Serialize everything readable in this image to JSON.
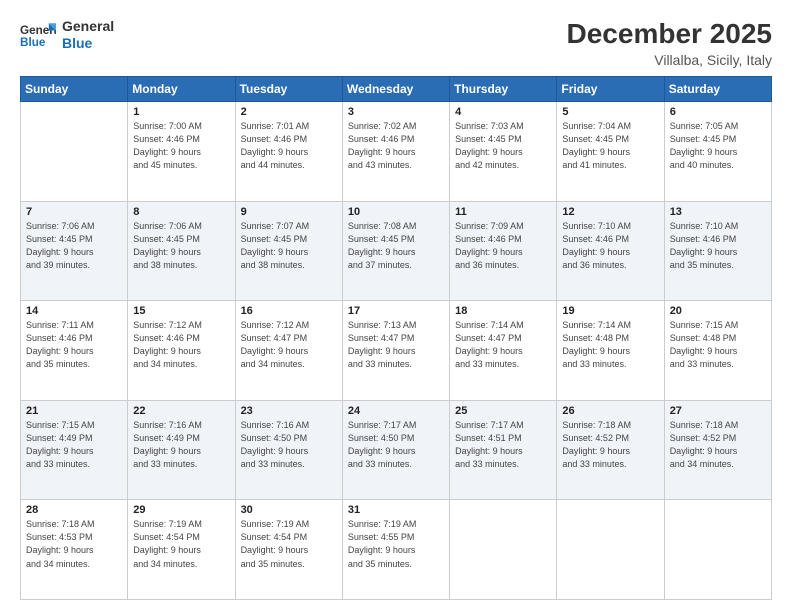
{
  "logo": {
    "line1": "General",
    "line2": "Blue"
  },
  "title": "December 2025",
  "subtitle": "Villalba, Sicily, Italy",
  "days_header": [
    "Sunday",
    "Monday",
    "Tuesday",
    "Wednesday",
    "Thursday",
    "Friday",
    "Saturday"
  ],
  "weeks": [
    [
      {
        "day": "",
        "info": ""
      },
      {
        "day": "1",
        "info": "Sunrise: 7:00 AM\nSunset: 4:46 PM\nDaylight: 9 hours\nand 45 minutes."
      },
      {
        "day": "2",
        "info": "Sunrise: 7:01 AM\nSunset: 4:46 PM\nDaylight: 9 hours\nand 44 minutes."
      },
      {
        "day": "3",
        "info": "Sunrise: 7:02 AM\nSunset: 4:46 PM\nDaylight: 9 hours\nand 43 minutes."
      },
      {
        "day": "4",
        "info": "Sunrise: 7:03 AM\nSunset: 4:45 PM\nDaylight: 9 hours\nand 42 minutes."
      },
      {
        "day": "5",
        "info": "Sunrise: 7:04 AM\nSunset: 4:45 PM\nDaylight: 9 hours\nand 41 minutes."
      },
      {
        "day": "6",
        "info": "Sunrise: 7:05 AM\nSunset: 4:45 PM\nDaylight: 9 hours\nand 40 minutes."
      }
    ],
    [
      {
        "day": "7",
        "info": "Sunrise: 7:06 AM\nSunset: 4:45 PM\nDaylight: 9 hours\nand 39 minutes."
      },
      {
        "day": "8",
        "info": "Sunrise: 7:06 AM\nSunset: 4:45 PM\nDaylight: 9 hours\nand 38 minutes."
      },
      {
        "day": "9",
        "info": "Sunrise: 7:07 AM\nSunset: 4:45 PM\nDaylight: 9 hours\nand 38 minutes."
      },
      {
        "day": "10",
        "info": "Sunrise: 7:08 AM\nSunset: 4:45 PM\nDaylight: 9 hours\nand 37 minutes."
      },
      {
        "day": "11",
        "info": "Sunrise: 7:09 AM\nSunset: 4:46 PM\nDaylight: 9 hours\nand 36 minutes."
      },
      {
        "day": "12",
        "info": "Sunrise: 7:10 AM\nSunset: 4:46 PM\nDaylight: 9 hours\nand 36 minutes."
      },
      {
        "day": "13",
        "info": "Sunrise: 7:10 AM\nSunset: 4:46 PM\nDaylight: 9 hours\nand 35 minutes."
      }
    ],
    [
      {
        "day": "14",
        "info": "Sunrise: 7:11 AM\nSunset: 4:46 PM\nDaylight: 9 hours\nand 35 minutes."
      },
      {
        "day": "15",
        "info": "Sunrise: 7:12 AM\nSunset: 4:46 PM\nDaylight: 9 hours\nand 34 minutes."
      },
      {
        "day": "16",
        "info": "Sunrise: 7:12 AM\nSunset: 4:47 PM\nDaylight: 9 hours\nand 34 minutes."
      },
      {
        "day": "17",
        "info": "Sunrise: 7:13 AM\nSunset: 4:47 PM\nDaylight: 9 hours\nand 33 minutes."
      },
      {
        "day": "18",
        "info": "Sunrise: 7:14 AM\nSunset: 4:47 PM\nDaylight: 9 hours\nand 33 minutes."
      },
      {
        "day": "19",
        "info": "Sunrise: 7:14 AM\nSunset: 4:48 PM\nDaylight: 9 hours\nand 33 minutes."
      },
      {
        "day": "20",
        "info": "Sunrise: 7:15 AM\nSunset: 4:48 PM\nDaylight: 9 hours\nand 33 minutes."
      }
    ],
    [
      {
        "day": "21",
        "info": "Sunrise: 7:15 AM\nSunset: 4:49 PM\nDaylight: 9 hours\nand 33 minutes."
      },
      {
        "day": "22",
        "info": "Sunrise: 7:16 AM\nSunset: 4:49 PM\nDaylight: 9 hours\nand 33 minutes."
      },
      {
        "day": "23",
        "info": "Sunrise: 7:16 AM\nSunset: 4:50 PM\nDaylight: 9 hours\nand 33 minutes."
      },
      {
        "day": "24",
        "info": "Sunrise: 7:17 AM\nSunset: 4:50 PM\nDaylight: 9 hours\nand 33 minutes."
      },
      {
        "day": "25",
        "info": "Sunrise: 7:17 AM\nSunset: 4:51 PM\nDaylight: 9 hours\nand 33 minutes."
      },
      {
        "day": "26",
        "info": "Sunrise: 7:18 AM\nSunset: 4:52 PM\nDaylight: 9 hours\nand 33 minutes."
      },
      {
        "day": "27",
        "info": "Sunrise: 7:18 AM\nSunset: 4:52 PM\nDaylight: 9 hours\nand 34 minutes."
      }
    ],
    [
      {
        "day": "28",
        "info": "Sunrise: 7:18 AM\nSunset: 4:53 PM\nDaylight: 9 hours\nand 34 minutes."
      },
      {
        "day": "29",
        "info": "Sunrise: 7:19 AM\nSunset: 4:54 PM\nDaylight: 9 hours\nand 34 minutes."
      },
      {
        "day": "30",
        "info": "Sunrise: 7:19 AM\nSunset: 4:54 PM\nDaylight: 9 hours\nand 35 minutes."
      },
      {
        "day": "31",
        "info": "Sunrise: 7:19 AM\nSunset: 4:55 PM\nDaylight: 9 hours\nand 35 minutes."
      },
      {
        "day": "",
        "info": ""
      },
      {
        "day": "",
        "info": ""
      },
      {
        "day": "",
        "info": ""
      }
    ]
  ]
}
